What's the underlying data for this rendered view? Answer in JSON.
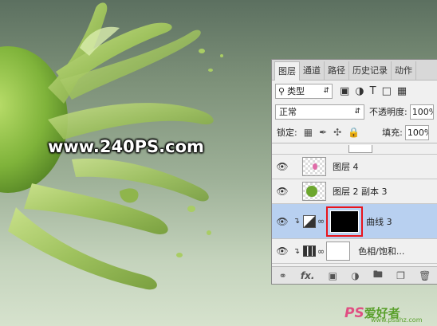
{
  "watermark": "www.240PS.com",
  "logo": {
    "ps": "PS",
    "cn": "爱好者",
    "url": "www.psahz.com"
  },
  "colors": {
    "accent_highlight": "#e8141c",
    "selected_layer": "#b8d0f0"
  },
  "layers_panel": {
    "tabs": [
      "图层",
      "通道",
      "路径",
      "历史记录",
      "动作"
    ],
    "active_tab": "图层",
    "filter": {
      "icon": "search-icon",
      "value": "类型"
    },
    "blend_mode": "正常",
    "opacity_label": "不透明度:",
    "opacity_value": "100%",
    "lock_label": "锁定:",
    "fill_label": "填充:",
    "fill_value": "100%",
    "layers": [
      {
        "name": "图层 4",
        "type": "pixel",
        "thumb_icon": "pink-dot-icon",
        "selected": false
      },
      {
        "name": "图层 2 副本 3",
        "type": "pixel",
        "thumb_icon": "green-apple-icon",
        "selected": false
      },
      {
        "name": "曲线 3",
        "type": "adjustment",
        "thumb_icon": "curves-icon",
        "selected": true
      },
      {
        "name": "色相/饱和...",
        "type": "adjustment",
        "thumb_icon": "hue-sat-icon",
        "selected": false
      }
    ],
    "footer_icons": [
      "link-icon",
      "fx-icon",
      "mask-icon",
      "adjustment-icon",
      "folder-icon",
      "new-layer-icon",
      "trash-icon"
    ],
    "footer_fx": "fx."
  }
}
